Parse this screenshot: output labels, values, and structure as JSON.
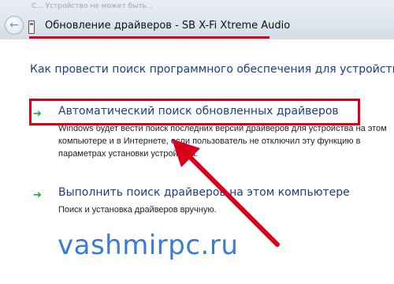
{
  "titlebar": {
    "faded_caption": "С... Устройство не может быть...",
    "title": "Обновление драйверов - SB X-Fi Xtreme Audio",
    "back_glyph": "←"
  },
  "heading": "Как провести поиск программного обеспечения для устройств?",
  "options": [
    {
      "label": "Автоматический поиск обновленных драйверов",
      "desc": "Windows будет вести поиск последних версий драйверов для устройства на этом компьютере и в Интернете, если пользователь не отключил эту функцию в параметрах установки устройства.",
      "arrow": "➔"
    },
    {
      "label": "Выполнить поиск драйверов на этом компьютере",
      "desc": "Поиск и установка драйверов вручную.",
      "arrow": "➔"
    }
  ],
  "watermark": "vashmirpc.ru",
  "colors": {
    "annotation": "#d8001a",
    "link": "#1e3c8c",
    "arrow_green": "#2aa53a",
    "watermark": "#3a7bd5"
  }
}
